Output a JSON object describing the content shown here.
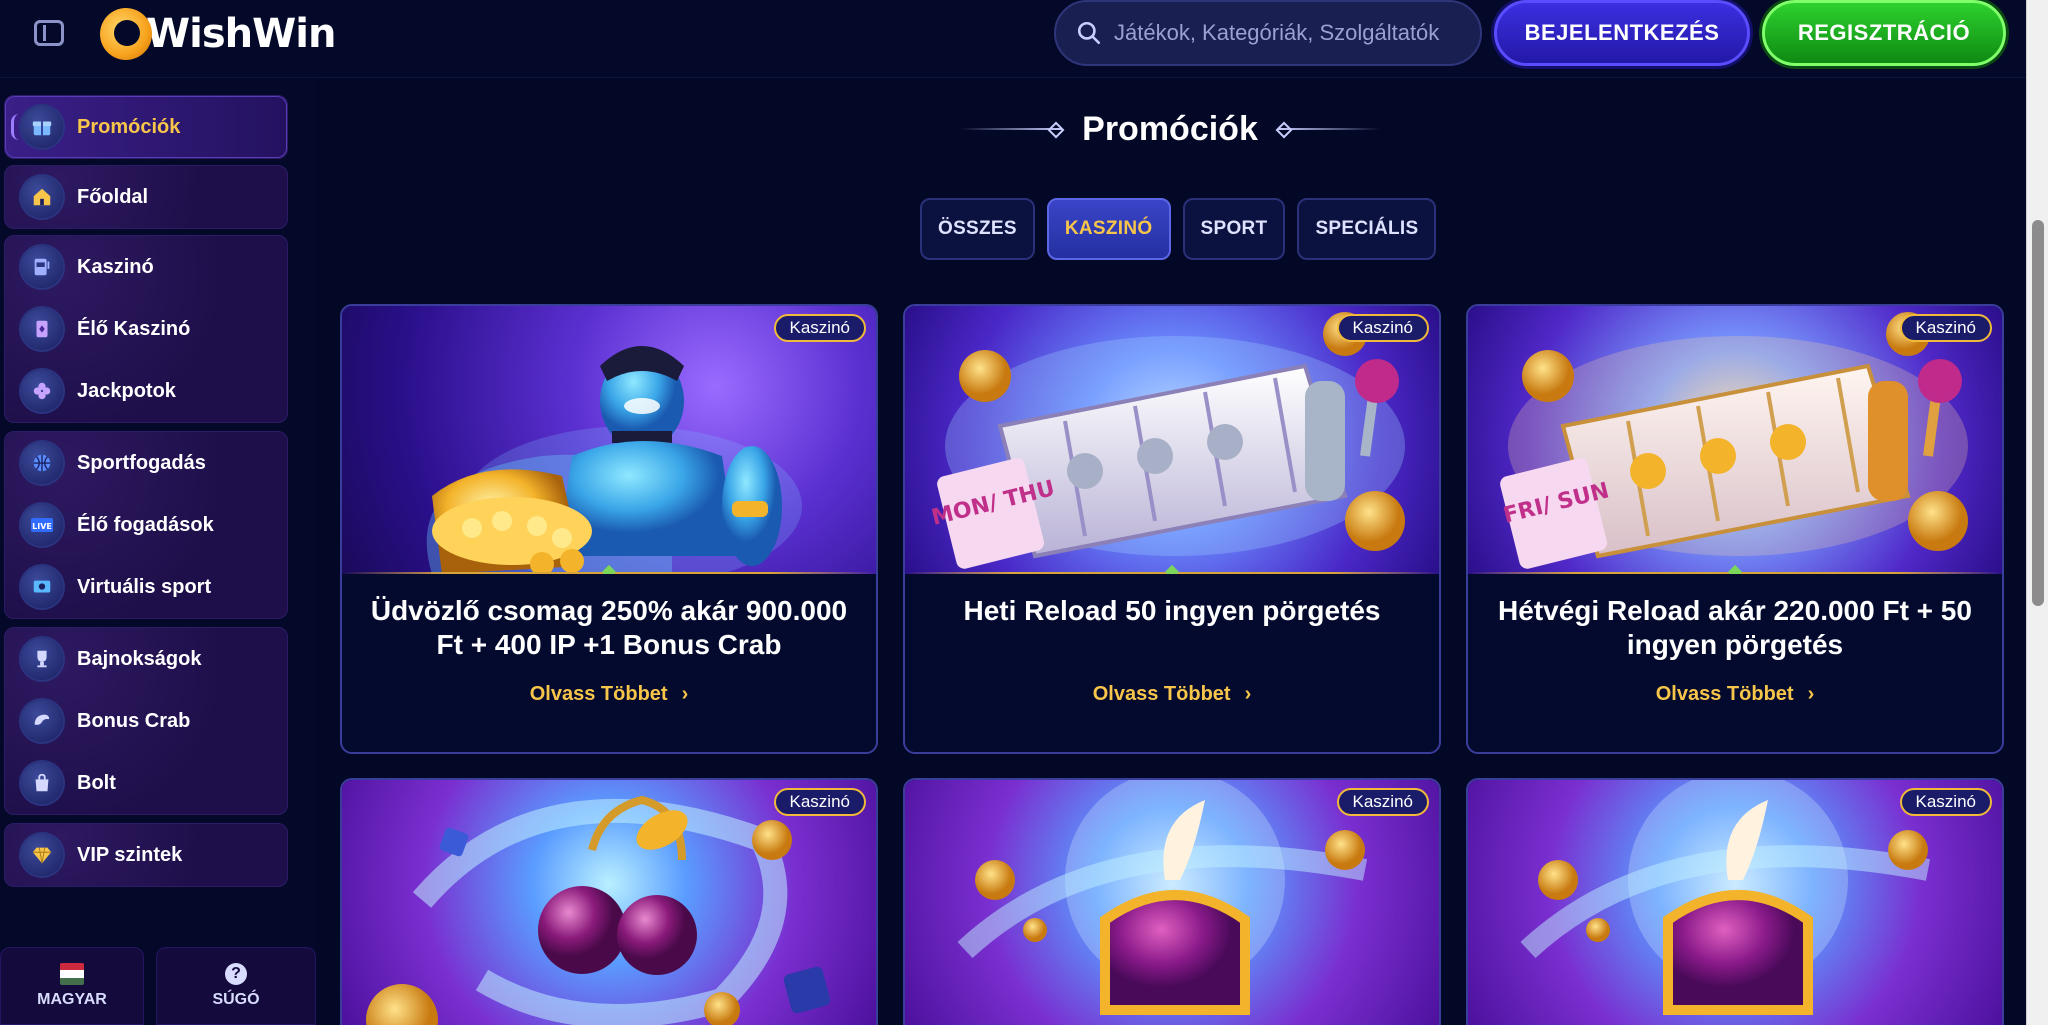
{
  "header": {
    "logo_text": "WishWin",
    "search_placeholder": "Játékok, Kategóriák, Szolgáltatók",
    "login_label": "BEJELENTKEZÉS",
    "register_label": "REGISZTRÁCIÓ"
  },
  "sidebar": {
    "groups": [
      {
        "items": [
          {
            "label": "Promóciók",
            "icon": "gift-icon",
            "active": true
          }
        ]
      },
      {
        "items": [
          {
            "label": "Főoldal",
            "icon": "home-icon"
          }
        ]
      },
      {
        "items": [
          {
            "label": "Kaszinó",
            "icon": "slot-machine-icon"
          },
          {
            "label": "Élő Kaszinó",
            "icon": "playing-card-icon"
          },
          {
            "label": "Jackpotok",
            "icon": "clover-icon"
          }
        ]
      },
      {
        "items": [
          {
            "label": "Sportfogadás",
            "icon": "basketball-icon"
          },
          {
            "label": "Élő fogadások",
            "icon": "live-icon"
          },
          {
            "label": "Virtuális sport",
            "icon": "virtual-sport-icon"
          }
        ]
      },
      {
        "items": [
          {
            "label": "Bajnokságok",
            "icon": "trophy-icon"
          },
          {
            "label": "Bonus Crab",
            "icon": "claw-icon"
          },
          {
            "label": "Bolt",
            "icon": "shopping-bag-icon"
          }
        ]
      },
      {
        "items": [
          {
            "label": "VIP szintek",
            "icon": "diamond-icon"
          }
        ]
      }
    ],
    "footer": {
      "language_label": "MAGYAR",
      "help_label": "SÚGÓ",
      "help_glyph": "?",
      "flag_colors": [
        "#cd2a3e",
        "#ffffff",
        "#436f4d"
      ]
    }
  },
  "main": {
    "title": "Promóciók",
    "tabs": [
      {
        "label": "ÖSSZES",
        "active": false
      },
      {
        "label": "KASZINÓ",
        "active": true
      },
      {
        "label": "SPORT",
        "active": false
      },
      {
        "label": "SPECIÁLIS",
        "active": false
      }
    ],
    "cards": [
      {
        "badge": "Kaszinó",
        "title": "Üdvözlő csomag 250% akár 900.000 Ft + 400 IP +1 Bonus Crab",
        "link": "Olvass Többet",
        "art": "genie"
      },
      {
        "badge": "Kaszinó",
        "title": "Heti Reload 50 ingyen pörgetés",
        "link": "Olvass Többet",
        "art": "slot-mon-thu",
        "scroll_text": "MON/ THU"
      },
      {
        "badge": "Kaszinó",
        "title": "Hétvégi Reload akár 220.000 Ft + 50 ingyen pörgetés",
        "link": "Olvass Többet",
        "art": "slot-fri-sun",
        "scroll_text": "FRI/ SUN"
      },
      {
        "badge": "Kaszinó",
        "art": "cherries"
      },
      {
        "badge": "Kaszinó",
        "art": "treasure-chest"
      },
      {
        "badge": "Kaszinó",
        "art": "treasure-chest"
      }
    ]
  },
  "colors": {
    "background": "#030826",
    "accent_gold": "#f7c54a",
    "login_blue": "#3b2fe0",
    "register_green": "#2ed12e",
    "card_border": "#3a3d9a"
  }
}
